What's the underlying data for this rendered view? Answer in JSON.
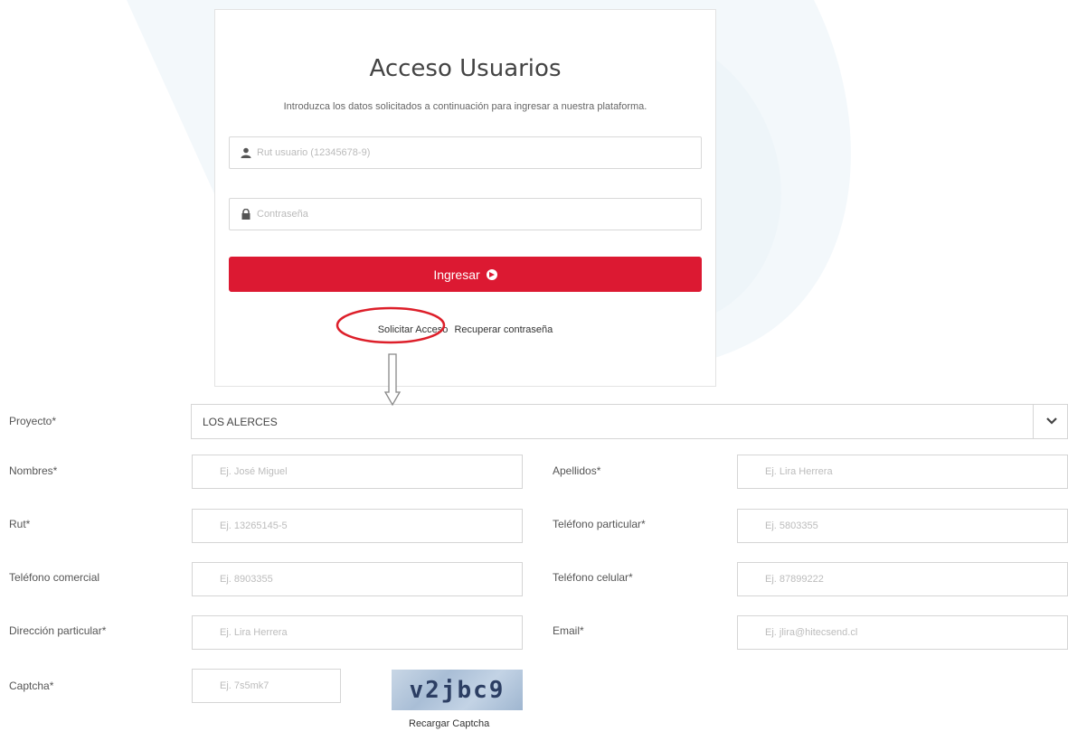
{
  "login": {
    "title": "Acceso Usuarios",
    "subtitle": "Introduzca los datos solicitados a continuación para ingresar a nuestra plataforma.",
    "rut_placeholder": "Rut usuario (12345678-9)",
    "password_placeholder": "Contraseña",
    "submit_label": "Ingresar",
    "link_request_access": "Solicitar Acceso",
    "link_recover_password": "Recuperar contraseña"
  },
  "form": {
    "proyecto": {
      "label": "Proyecto*",
      "value": "LOS ALERCES"
    },
    "nombres": {
      "label": "Nombres*",
      "placeholder": "Ej. José Miguel"
    },
    "apellidos": {
      "label": "Apellidos*",
      "placeholder": "Ej. Lira Herrera"
    },
    "rut": {
      "label": "Rut*",
      "placeholder": "Ej. 13265145-5"
    },
    "telefono_particular": {
      "label": "Teléfono particular*",
      "placeholder": "Ej. 5803355"
    },
    "telefono_comercial": {
      "label": "Teléfono comercial",
      "placeholder": "Ej. 8903355"
    },
    "telefono_celular": {
      "label": "Teléfono celular*",
      "placeholder": "Ej. 87899222"
    },
    "direccion_particular": {
      "label": "Dirección particular*",
      "placeholder": "Ej. Lira Herrera"
    },
    "email": {
      "label": "Email*",
      "placeholder": "Ej. jlira@hitecsend.cl"
    },
    "captcha": {
      "label": "Captcha*",
      "placeholder": "Ej. 7s5mk7",
      "image_text": "v2jbc9",
      "reload_label": "Recargar Captcha"
    }
  },
  "colors": {
    "primary_button": "#dc1932",
    "highlight": "#dd1f2a",
    "watermark": "#eef5f9"
  },
  "icons": {
    "rut_input": "user-icon",
    "password_input": "lock-icon",
    "submit": "arrow-circle-right-icon",
    "select": "chevron-down-icon"
  }
}
